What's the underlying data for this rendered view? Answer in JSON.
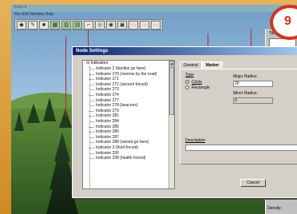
{
  "badge": {
    "number": "9"
  },
  "editor": {
    "title": "Build It",
    "menu": "File   Edit   Window   Help",
    "toolbar": [
      {
        "icon": "diamond-icon",
        "glyph": "◆"
      },
      {
        "icon": "pencil-icon",
        "glyph": "✎"
      },
      {
        "icon": "save-icon",
        "glyph": "■"
      },
      {
        "icon": "terrain-icon",
        "glyph": "▦"
      },
      {
        "icon": "grid-icon",
        "glyph": "▥"
      },
      {
        "icon": "layer-icon",
        "glyph": "▤"
      },
      {
        "icon": "tag-icon",
        "glyph": "⌐"
      },
      {
        "icon": "camera-icon",
        "glyph": "◎"
      },
      {
        "icon": "eye-icon",
        "glyph": "◉"
      },
      {
        "icon": "picture-icon",
        "glyph": "▣"
      },
      {
        "icon": "ghost1-icon",
        "glyph": "▭"
      },
      {
        "icon": "ghost2-icon",
        "glyph": "▭"
      },
      {
        "icon": "ghost3-icon",
        "glyph": "▭"
      }
    ],
    "side": {
      "label": "Tiles",
      "density_label": "Density:"
    }
  },
  "dialog": {
    "title": "Node Settings",
    "tree": {
      "root": "Indicators",
      "items": [
        "Indicator 2 (familiar go here)",
        "Indicator 270 (memos by the road)",
        "Indicator 271",
        "Indicator 272 (second forced)",
        "Indicator 273",
        "Indicator 274",
        "Indicator 277",
        "Indicator 278 (beacons)",
        "Indicator 279",
        "Indicator 281",
        "Indicator 284",
        "Indicator 285",
        "Indicator 286",
        "Indicator 287",
        "Indicator 288 (wizard go here)",
        "Indicator 3 (third forced)",
        "Indicator 336",
        "Indicator 338 (health forced)"
      ]
    },
    "tabs": [
      "General",
      "Marker"
    ],
    "marker": {
      "type_label": "Type",
      "circle": "Circle",
      "rectangle": "Rectangle",
      "major_label": "Major Radius",
      "major_value": "20",
      "minor_label": "Minor Radius",
      "minor_value": "0",
      "desc_label": "Description",
      "desc_value": ""
    },
    "cancel": "Cancel"
  }
}
